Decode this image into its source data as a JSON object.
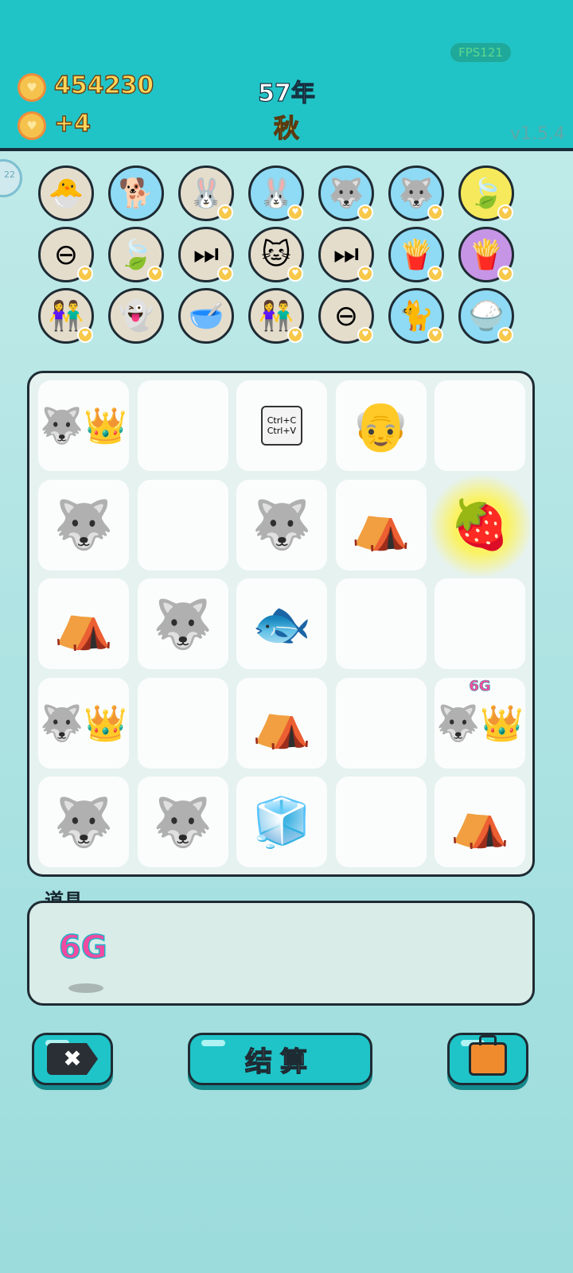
{
  "hud": {
    "coins": "454230",
    "income": "+4",
    "year": "57年",
    "season": "秋",
    "fps": "FPS121",
    "version": "v1.5.4",
    "side_badge": "22"
  },
  "collection_rows": [
    [
      {
        "icon": "chick-egg-icon",
        "glyph": "🐣",
        "bg": "beige",
        "heart": false
      },
      {
        "icon": "cool-dog-icon",
        "glyph": "🐕",
        "bg": "blue",
        "heart": false
      },
      {
        "icon": "rabbit-icon",
        "glyph": "🐰",
        "bg": "beige",
        "heart": true
      },
      {
        "icon": "rabbit-icon",
        "glyph": "🐰",
        "bg": "blue",
        "heart": true
      },
      {
        "icon": "husky-icon",
        "glyph": "🐺",
        "bg": "blue",
        "heart": true
      },
      {
        "icon": "husky-icon",
        "glyph": "🐺",
        "bg": "blue",
        "heart": true
      },
      {
        "icon": "leaf-icon",
        "glyph": "🍃",
        "bg": "yellow",
        "heart": true
      }
    ],
    [
      {
        "icon": "minus-sign-icon",
        "glyph": "⊖",
        "bg": "beige",
        "heart": true
      },
      {
        "icon": "leaf-icon",
        "glyph": "🍃",
        "bg": "beige",
        "heart": true
      },
      {
        "icon": "skip-icon",
        "glyph": "⏭",
        "bg": "beige",
        "heart": true
      },
      {
        "icon": "cat-pair-icon",
        "glyph": "🐱",
        "bg": "beige",
        "heart": true
      },
      {
        "icon": "skip-icon",
        "glyph": "⏭",
        "bg": "beige",
        "heart": true
      },
      {
        "icon": "fries-icon",
        "glyph": "🍟",
        "bg": "blue",
        "heart": true
      },
      {
        "icon": "fries-icon",
        "glyph": "🍟",
        "bg": "purple",
        "heart": true
      }
    ],
    [
      {
        "icon": "couple-icon",
        "glyph": "👫",
        "bg": "beige",
        "heart": true
      },
      {
        "icon": "ghost-icon",
        "glyph": "👻",
        "bg": "beige",
        "heart": false
      },
      {
        "icon": "pet-food-bowl-icon",
        "glyph": "🥣",
        "bg": "beige",
        "heart": false
      },
      {
        "icon": "couple-icon",
        "glyph": "👫",
        "bg": "beige",
        "heart": true
      },
      {
        "icon": "minus-sign-icon",
        "glyph": "⊖",
        "bg": "beige",
        "heart": true
      },
      {
        "icon": "cat-icon",
        "glyph": "🐈",
        "bg": "blue",
        "heart": true
      },
      {
        "icon": "rice-bowl-icon",
        "glyph": "🍚",
        "bg": "blue",
        "heart": true
      }
    ]
  ],
  "board": [
    [
      {
        "item": "king-husky-icon",
        "glyph": "🐺👑"
      },
      {
        "item": "empty",
        "glyph": ""
      },
      {
        "item": "copy-paste-cards-icon",
        "glyph": "Ctrl+C\nCtrl+V"
      },
      {
        "item": "bald-grandpa-icon",
        "glyph": "👴"
      },
      {
        "item": "empty",
        "glyph": ""
      }
    ],
    [
      {
        "item": "husky-icon",
        "glyph": "🐺"
      },
      {
        "item": "empty",
        "glyph": ""
      },
      {
        "item": "husky-icon",
        "glyph": "🐺"
      },
      {
        "item": "rabbit-tent-icon",
        "glyph": "⛺"
      },
      {
        "item": "strawberry-icon",
        "glyph": "🍓"
      }
    ],
    [
      {
        "item": "rabbit-tent-icon",
        "glyph": "⛺"
      },
      {
        "item": "husky-icon",
        "glyph": "🐺"
      },
      {
        "item": "koi-fish-icon",
        "glyph": "🐟"
      },
      {
        "item": "empty",
        "glyph": ""
      },
      {
        "item": "empty",
        "glyph": ""
      }
    ],
    [
      {
        "item": "king-husky-icon",
        "glyph": "🐺👑"
      },
      {
        "item": "empty",
        "glyph": ""
      },
      {
        "item": "rabbit-tent-icon",
        "glyph": "⛺"
      },
      {
        "item": "empty",
        "glyph": ""
      },
      {
        "item": "king-husky-6g-icon",
        "glyph": "🐺👑",
        "tag": "6G"
      }
    ],
    [
      {
        "item": "husky-icon",
        "glyph": "🐺"
      },
      {
        "item": "husky-icon",
        "glyph": "🐺"
      },
      {
        "item": "fridge-icon",
        "glyph": "🧊"
      },
      {
        "item": "empty",
        "glyph": ""
      },
      {
        "item": "rabbit-tent-icon",
        "glyph": "⛺"
      }
    ]
  ],
  "props": {
    "label": "道具",
    "item": "6G"
  },
  "buttons": {
    "close_glyph": "✖",
    "settle_label": "结算"
  }
}
